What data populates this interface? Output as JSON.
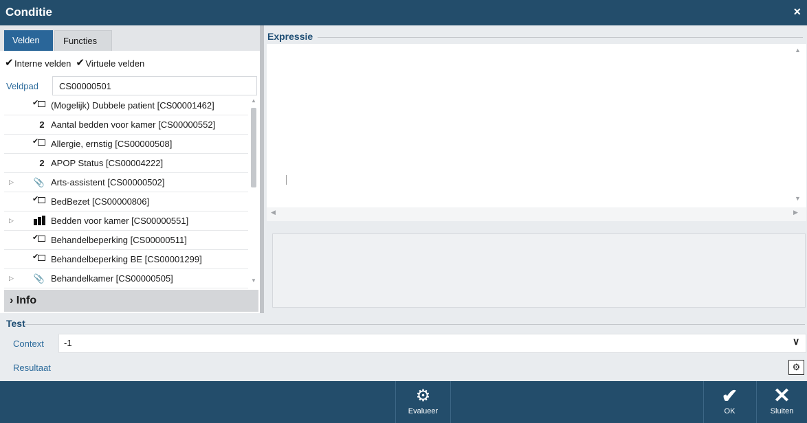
{
  "window": {
    "title": "Conditie",
    "close_icon": "×"
  },
  "tabs": [
    {
      "label": "Velden",
      "active": true
    },
    {
      "label": "Functies",
      "active": false
    }
  ],
  "checkboxes": {
    "internal": {
      "label": "Interne velden",
      "checked": true
    },
    "virtual": {
      "label": "Virtuele velden",
      "checked": true
    }
  },
  "veldpad": {
    "label": "Veldpad",
    "value": "CS00000501"
  },
  "fields": [
    {
      "icon": "checkbox-icon",
      "expandable": false,
      "label": "(Mogelijk) Dubbele patient [CS00001462]"
    },
    {
      "icon": "number-icon",
      "icon_text": "2",
      "expandable": false,
      "label": "Aantal bedden voor kamer [CS00000552]"
    },
    {
      "icon": "checkbox-icon",
      "expandable": false,
      "label": "Allergie, ernstig [CS00000508]"
    },
    {
      "icon": "number-icon",
      "icon_text": "2",
      "expandable": false,
      "label": "APOP Status [CS00004222]"
    },
    {
      "icon": "paperclip-icon",
      "icon_text": "📎",
      "expandable": true,
      "label": "Arts-assistent [CS00000502]"
    },
    {
      "icon": "checkbox-icon",
      "expandable": false,
      "label": "BedBezet [CS00000806]"
    },
    {
      "icon": "bars-icon",
      "expandable": true,
      "label": "Bedden voor kamer [CS00000551]"
    },
    {
      "icon": "checkbox-icon",
      "expandable": false,
      "label": "Behandelbeperking [CS00000511]"
    },
    {
      "icon": "checkbox-icon",
      "expandable": false,
      "label": "Behandelbeperking BE [CS00001299]"
    },
    {
      "icon": "paperclip-icon",
      "icon_text": "📎",
      "expandable": true,
      "label": "Behandelkamer [CS00000505]"
    }
  ],
  "info": {
    "label": "› Info"
  },
  "expressie": {
    "label": "Expressie",
    "value": ""
  },
  "test": {
    "label": "Test",
    "context_label": "Context",
    "context_value": "-1",
    "result_label": "Resultaat"
  },
  "footer": {
    "evaluate_label": "Evalueer",
    "ok_label": "OK",
    "close_label": "Sluiten"
  },
  "colors": {
    "titlebar": "#234d6b",
    "tab_active": "#2a6699",
    "label_blue": "#2b6a9b"
  }
}
